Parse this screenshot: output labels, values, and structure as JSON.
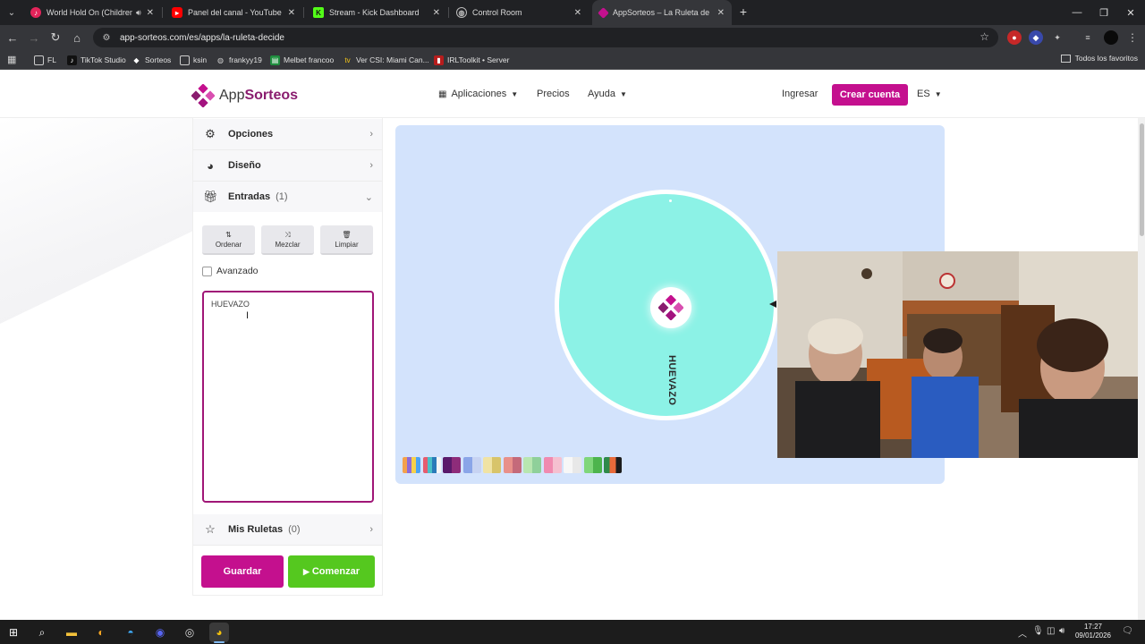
{
  "browser": {
    "tabs": [
      {
        "title": "World Hold On (Children O",
        "favicon": "music-icon",
        "color": "#e3245a",
        "audio": true
      },
      {
        "title": "Panel del canal - YouTube Studi",
        "favicon": "youtube-icon",
        "color": "#ff0000"
      },
      {
        "title": "Stream - Kick Dashboard",
        "favicon": "kick-icon",
        "color": "#53fc18"
      },
      {
        "title": "Control Room",
        "favicon": "globe-icon",
        "color": "#9aa0a6"
      },
      {
        "title": "AppSorteos – La Ruleta de la S",
        "favicon": "appsorteos-icon",
        "color": "#c4108e",
        "active": true
      }
    ],
    "url": "app-sorteos.com/es/apps/la-ruleta-decide",
    "bookmarks": [
      {
        "label": "FL",
        "icon": "folder-icon"
      },
      {
        "label": "TikTok Studio",
        "icon": "tiktok-icon"
      },
      {
        "label": "Sorteos",
        "icon": "appsorteos-icon"
      },
      {
        "label": "ksin",
        "icon": "folder-icon"
      },
      {
        "label": "frankyy19",
        "icon": "globe-icon"
      },
      {
        "label": "Melbet francoo",
        "icon": "sheets-icon"
      },
      {
        "label": "Ver CSI: Miami Can...",
        "icon": "tv-icon"
      },
      {
        "label": "IRLToolkit • Server",
        "icon": "irl-icon"
      }
    ],
    "all_bookmarks": "Todos los favoritos"
  },
  "header": {
    "logo_app": "App",
    "logo_brand": "Sorteos",
    "nav": {
      "apps": "Aplicaciones",
      "prices": "Precios",
      "help": "Ayuda"
    },
    "login": "Ingresar",
    "signup": "Crear cuenta",
    "language": "ES",
    "brand_color": "#c4108e"
  },
  "panel": {
    "options": "Opciones",
    "design": "Diseño",
    "entries_title": "Entradas",
    "entries_count": "(1)",
    "tools": {
      "sort": "Ordenar",
      "shuffle": "Mezclar",
      "clear": "Limpiar"
    },
    "advanced": "Avanzado",
    "entries_value": "HUEVAZO",
    "my_wheels": "Mis Ruletas",
    "my_wheels_count": "(0)",
    "save": "Guardar",
    "start": "Comenzar"
  },
  "wheel": {
    "segments": [
      {
        "label": "HUEVAZO",
        "color": "#8cf2e6"
      }
    ],
    "background": "#d3e3fc",
    "palettes": [
      [
        "#f4a14b",
        "#8f6cd6",
        "#f7d14b",
        "#4ba3f4"
      ],
      [
        "#e65c6f",
        "#4bc0c8",
        "#2b7bb9",
        "#f5f5f5"
      ],
      [
        "#5a1a6b",
        "#8e2c7a"
      ],
      [
        "#8aa5e8",
        "#c7d3f2"
      ],
      [
        "#f0e3a4",
        "#d8c46a"
      ],
      [
        "#e8908a",
        "#c46a7a"
      ],
      [
        "#b8e6b0",
        "#8fd09a"
      ],
      [
        "#f08ab0",
        "#f5c0d0"
      ],
      [
        "#f7f7f7",
        "#e8e8e8"
      ],
      [
        "#7fd67a",
        "#4db44d"
      ],
      [
        "#2f8a4a",
        "#e86a3a",
        "#1c1c1c"
      ]
    ]
  },
  "taskbar": {
    "time": "17:27",
    "date": "09/01/2026"
  }
}
